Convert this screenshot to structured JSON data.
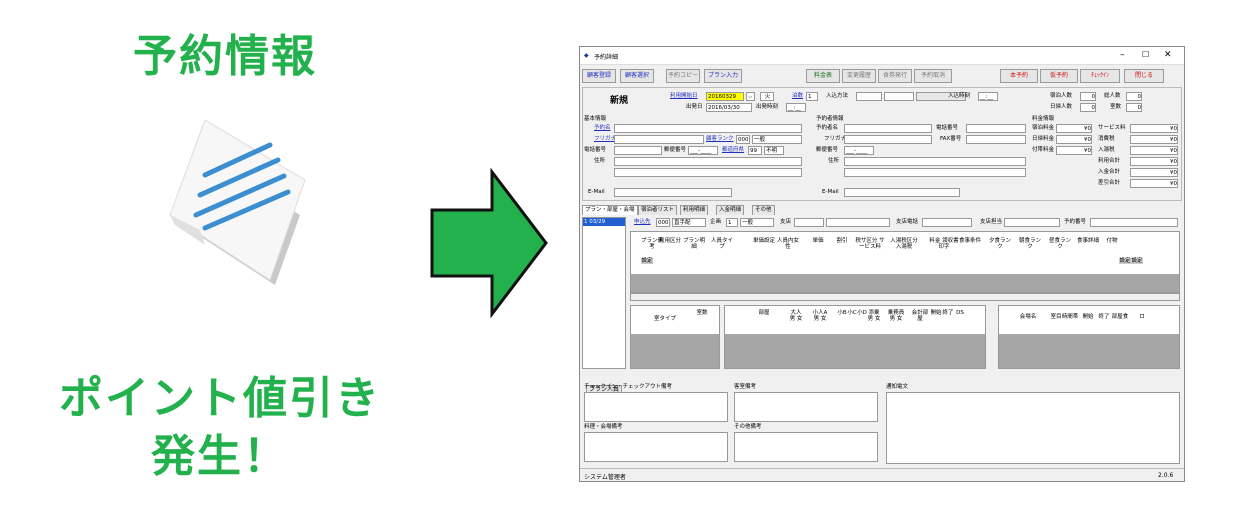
{
  "promo": {
    "title": "予約情報",
    "caption1": "ポイント値引き",
    "caption2": "発生！",
    "green": "#22b14c"
  },
  "window": {
    "title": "予約詳細",
    "toolbar": [
      "顧客登録",
      "顧客選択",
      "予約コピー",
      "プラン入力",
      "料金表",
      "変更履歴",
      "食券発行",
      "予約取消",
      "本予約",
      "仮予約",
      "ﾁｪｯｸｲﾝ",
      "閉じる"
    ],
    "status_new": "新規",
    "arrival_label": "利用開始日",
    "arrival_date": "20160329",
    "weekday": "火",
    "nights_label": "泊数",
    "nights": "1",
    "departure_label": "出発日",
    "departure_date": "2016/03/30",
    "depart_time_label": "出発時刻",
    "depart_time": "__:__",
    "entry_method_label": "入込方法",
    "entry_time_label": "入込時刻",
    "entry_time": "__:__",
    "stay": {
      "stay_count_label": "宿泊人数",
      "stay_count": "0",
      "total_label": "総人数",
      "total": "0",
      "day_label": "日帰人数",
      "day": "0",
      "rooms_label": "室数",
      "rooms": "0"
    },
    "basic": {
      "section": "基本情報",
      "name": "予約名",
      "kana": "フリガナ",
      "rank": "顧客ランク",
      "rank_code": "000",
      "rank_name": "一般",
      "phone": "電話番号",
      "zip": "郵便番号",
      "zip_val": "___-____",
      "pref": "都道府県",
      "pref_code": "99",
      "pref_name": "不明",
      "address": "住所",
      "email": "E-Mail"
    },
    "booker": {
      "section": "予約者情報",
      "name": "予約者名",
      "phone": "電話番号",
      "kana": "フリガナ",
      "fax": "FAX番号",
      "zip": "郵便番号",
      "zip_val": "___-____",
      "address": "住所",
      "email": "E-Mail"
    },
    "fee": {
      "section": "料金情報",
      "rows": [
        [
          "宿泊料金",
          "¥0",
          "サービス料",
          "¥0"
        ],
        [
          "日帰料金",
          "¥0",
          "消費税",
          "¥0"
        ],
        [
          "付帯料金",
          "¥0",
          "入湯税",
          "¥0"
        ],
        [
          "",
          "",
          "利用合計",
          "¥0"
        ],
        [
          "",
          "",
          "入金合計",
          "¥0"
        ],
        [
          "",
          "",
          "差引合計",
          "¥0"
        ]
      ]
    },
    "tabs": [
      "プラン・部屋・会場",
      "宿泊者リスト",
      "利用明細",
      "入金明細",
      "その他"
    ],
    "list_first": "1  03/29",
    "plan_row": {
      "applicant": "申込先",
      "app_code": "000",
      "app_name": "直手配",
      "kikaku": "企画",
      "kikaku_code": "1",
      "kikaku_name": "一般",
      "branch": "支店",
      "branch_phone": "支店電話",
      "branch_staff": "支店担当",
      "res_no": "予約番号"
    },
    "plan_headers": [
      "プラン備考",
      "利用区分",
      "プラン明細",
      "人員タイプ",
      "単価設定",
      "人員内女性",
      "単価",
      "割引",
      "税サ区分 サービス料",
      "入湯税区分 入湯税",
      "料金 領収書印字",
      "食事条件",
      "夕食ランク",
      "朝食ランク",
      "昼食ランク",
      "食事詳細",
      "付物"
    ],
    "setting": "設定",
    "room_headers": [
      "室タイプ",
      "室数"
    ],
    "room_detail_headers": [
      "部屋",
      "大人 男 女",
      "小人A 男 女",
      "小B",
      "小C",
      "小D",
      "添乗 男 女",
      "乗務員 男 女",
      "会計部屋",
      "開始",
      "終了",
      "DS"
    ],
    "venue_headers": [
      "会場名",
      "室目",
      "時間帯",
      "開始",
      "終了",
      "部屋食",
      "ロ"
    ],
    "plan_split_btn": "プラン人員割",
    "memos": [
      "チェックイン・チェックアウト備考",
      "客室備考",
      "通知電文",
      "料理・会場備考",
      "その他備考"
    ],
    "status_user": "システム管理者",
    "version": "2.0.6"
  }
}
